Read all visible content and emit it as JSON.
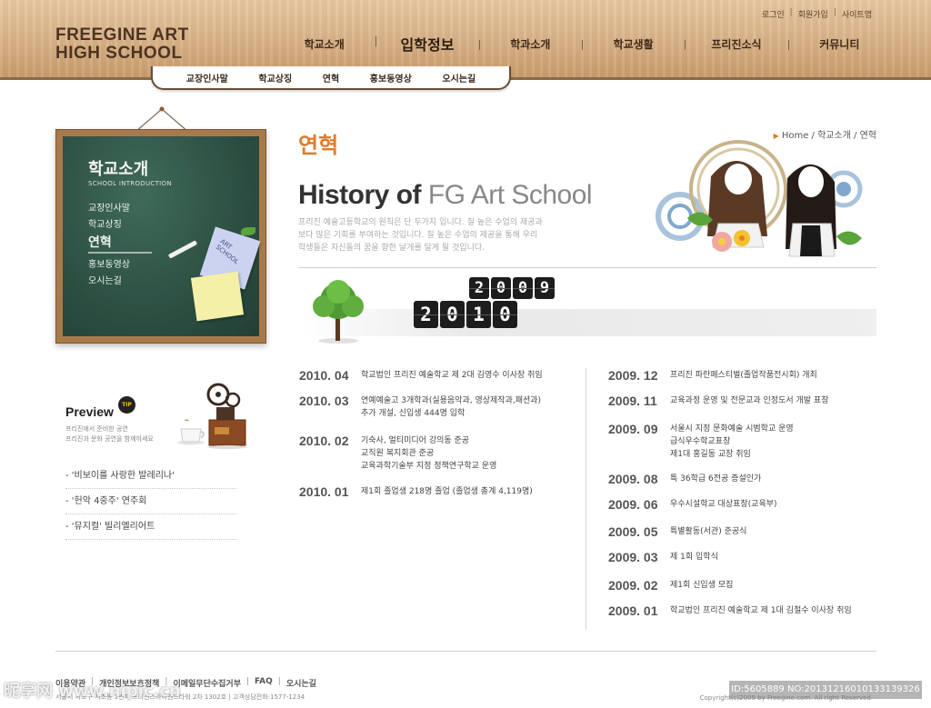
{
  "header": {
    "logo_line1": "FREEGINE ART",
    "logo_line2": "HIGH SCHOOL",
    "util_links": [
      "로그인",
      "회원가입",
      "사이트맵"
    ],
    "gnb": [
      "학교소개",
      "입학정보",
      "학과소개",
      "학교생활",
      "프리진소식",
      "커뮤니티"
    ],
    "subnav": [
      "교장인사말",
      "학교상징",
      "연혁",
      "홍보동영상",
      "오시는길"
    ]
  },
  "sidebar": {
    "board_title": "학교소개",
    "board_subtitle": "SCHOOL INTRODUCTION",
    "menu": [
      "교장인사말",
      "학교상징",
      "연혁",
      "홍보동영상",
      "오시는길"
    ],
    "active_index": 2,
    "note_text": "ART SCHOOL",
    "preview": {
      "title": "Preview",
      "badge": "TIP",
      "desc_line1": "프리진에서 준비한 공연",
      "desc_line2": "프리진과 문화 공연을 함께하세요",
      "items": [
        "- '비보이를 사랑한 발레리나'",
        "- '헌악 4중주' 연주회",
        "- '뮤지컬' 빌리엘리어트"
      ]
    }
  },
  "main": {
    "breadcrumb": "Home / 학교소개 / 연혁",
    "page_title": "연혁",
    "heading_bold": "History of",
    "heading_light": " FG Art School",
    "intro_lines": [
      "프리진 예술고등학교의 원칙은 단 두가지 입니다. 질 높은 수업의 제공과",
      "보다 많은 기회를 부여하는 것입니다. 질 높은 수업의 제공을 통해 우리",
      "학생들은 자신들의 꿈을 향한 날개를 달게 될 것입니다."
    ],
    "year_prev": [
      "2",
      "0",
      "0",
      "9"
    ],
    "year_current": [
      "2",
      "0",
      "1",
      "0"
    ],
    "timeline_2010": [
      {
        "date": "2010. 04",
        "lines": [
          "학교법인 프리진 예술학교 제 2대 김영수 이사장 취임"
        ]
      },
      {
        "date": "2010. 03",
        "lines": [
          "연예예술고 3개학과(실용음악과, 영상제작과,패션과)",
          "추가 개설, 신입생 444명 입학"
        ]
      },
      {
        "date": "2010. 02",
        "lines": [
          "기숙사, 멀티미디어 강의동 준공",
          "교직원 복지회관 준공",
          "교육과학기술부 지정 정책연구학교 운영"
        ]
      },
      {
        "date": "2010. 01",
        "lines": [
          "제1회 졸업생 218명 졸업 (졸업생 총계 4,119명)"
        ]
      }
    ],
    "timeline_2009": [
      {
        "date": "2009. 12",
        "lines": [
          "프리진 파란페스티벌(졸업작품전시회) 개최"
        ]
      },
      {
        "date": "2009. 11",
        "lines": [
          "교육과정 운영 및 전문교과 인정도서 개발 표창"
        ]
      },
      {
        "date": "2009. 09",
        "lines": [
          "서울시 지정 문화예술 시범학교 운영",
          "급식우수학교표창",
          "제1대 홍길동 교장 취임"
        ]
      },
      {
        "date": "2009. 08",
        "lines": [
          "특 36학급 6전공 증설인가"
        ]
      },
      {
        "date": "2009. 06",
        "lines": [
          "우수시설학교 대상표창(교육부)"
        ]
      },
      {
        "date": "2009. 05",
        "lines": [
          "특별활동(서관) 준공식"
        ]
      },
      {
        "date": "2009. 03",
        "lines": [
          "제 1회 입학식"
        ]
      },
      {
        "date": "2009. 02",
        "lines": [
          "제1회 신입생 모집"
        ]
      },
      {
        "date": "2009. 01",
        "lines": [
          "학교법인 프리진 예술학교 제 1대 김철수 이사장 취임"
        ]
      }
    ]
  },
  "footer": {
    "links": [
      "이용약관",
      "개인정보보호정책",
      "이메일무단수집거부",
      "FAQ",
      "오시는길"
    ],
    "address": "서울시 서초구 서초동 1번지 프리진스하이엔드타워 2차 1302호  |  고객상담전화:1577-1234",
    "copyright": "Copyright(c)2009 by Freegine.com. All right Reserved.",
    "watermark": "ID:5605889 NO:20131216010133139326",
    "watermark_left": "昵享网 www.nipic.cn"
  }
}
